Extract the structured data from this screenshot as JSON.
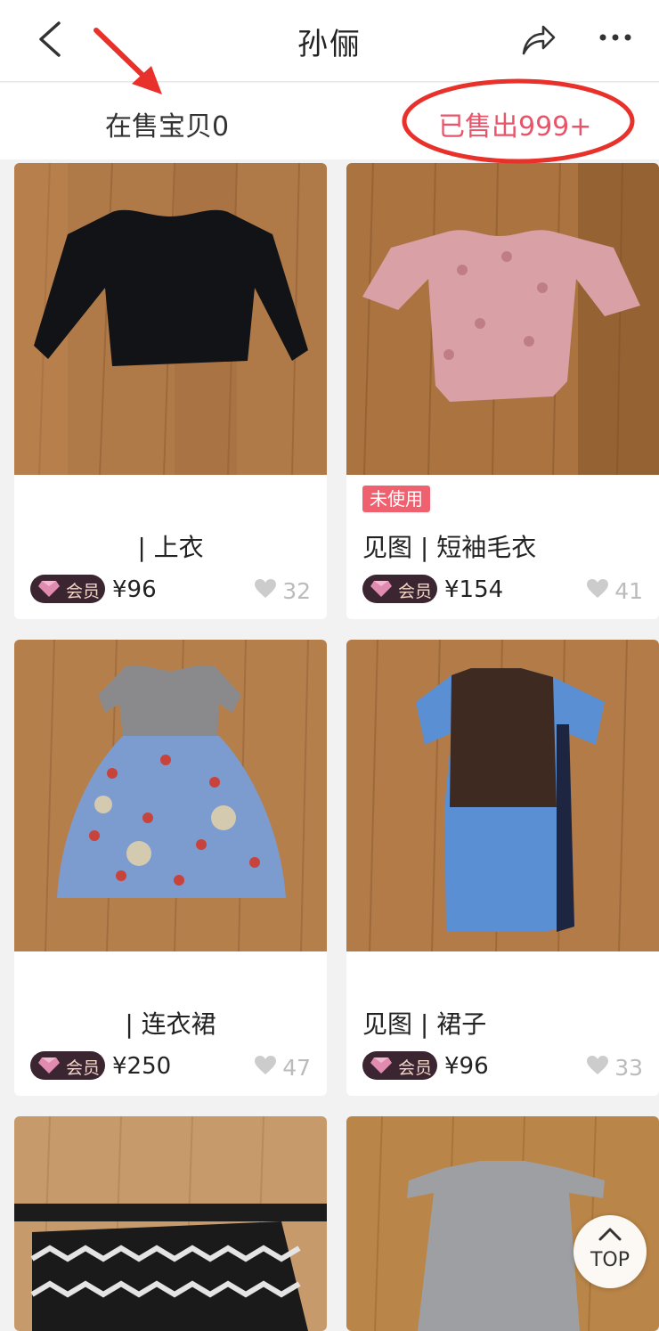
{
  "header": {
    "title": "孙俪",
    "back_icon": "chevron-left-icon",
    "share_icon": "share-icon",
    "more_icon": "more-icon"
  },
  "tabs": {
    "on_sale": "在售宝贝0",
    "sold": "已售出999+",
    "active_color": "#e8546a"
  },
  "products": [
    {
      "badge": "",
      "title": "| 上衣",
      "vip": "会员",
      "price": "¥96",
      "likes": "32"
    },
    {
      "badge": "未使用",
      "title": "见图 | 短袖毛衣",
      "vip": "会员",
      "price": "¥154",
      "likes": "41"
    },
    {
      "badge": "",
      "title": "| 连衣裙",
      "vip": "会员",
      "price": "¥250",
      "likes": "47"
    },
    {
      "badge": "",
      "title": "见图 | 裙子",
      "vip": "会员",
      "price": "¥96",
      "likes": "33"
    }
  ],
  "top_button": {
    "label": "TOP"
  },
  "annotation_color": "#e8312a"
}
